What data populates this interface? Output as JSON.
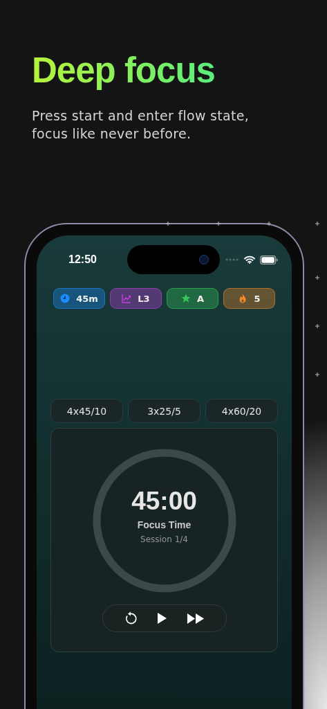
{
  "headline": "Deep focus",
  "subtitle": "Press start and enter flow state, focus like never before.",
  "status_bar": {
    "time": "12:50"
  },
  "badges": [
    {
      "kind": "clock",
      "label": "45m",
      "color": "#1a8cff"
    },
    {
      "kind": "chart",
      "label": "L3",
      "color": "#c43ee0"
    },
    {
      "kind": "star",
      "label": "A",
      "color": "#34c759"
    },
    {
      "kind": "flame",
      "label": "5",
      "color": "#f0892a"
    }
  ],
  "presets": [
    {
      "label": "4x45/10"
    },
    {
      "label": "3x25/5"
    },
    {
      "label": "4x60/20"
    }
  ],
  "timer": {
    "time": "45:00",
    "label": "Focus Time",
    "session": "Session 1/4"
  },
  "controls": [
    {
      "kind": "reset"
    },
    {
      "kind": "play"
    },
    {
      "kind": "skip"
    }
  ]
}
